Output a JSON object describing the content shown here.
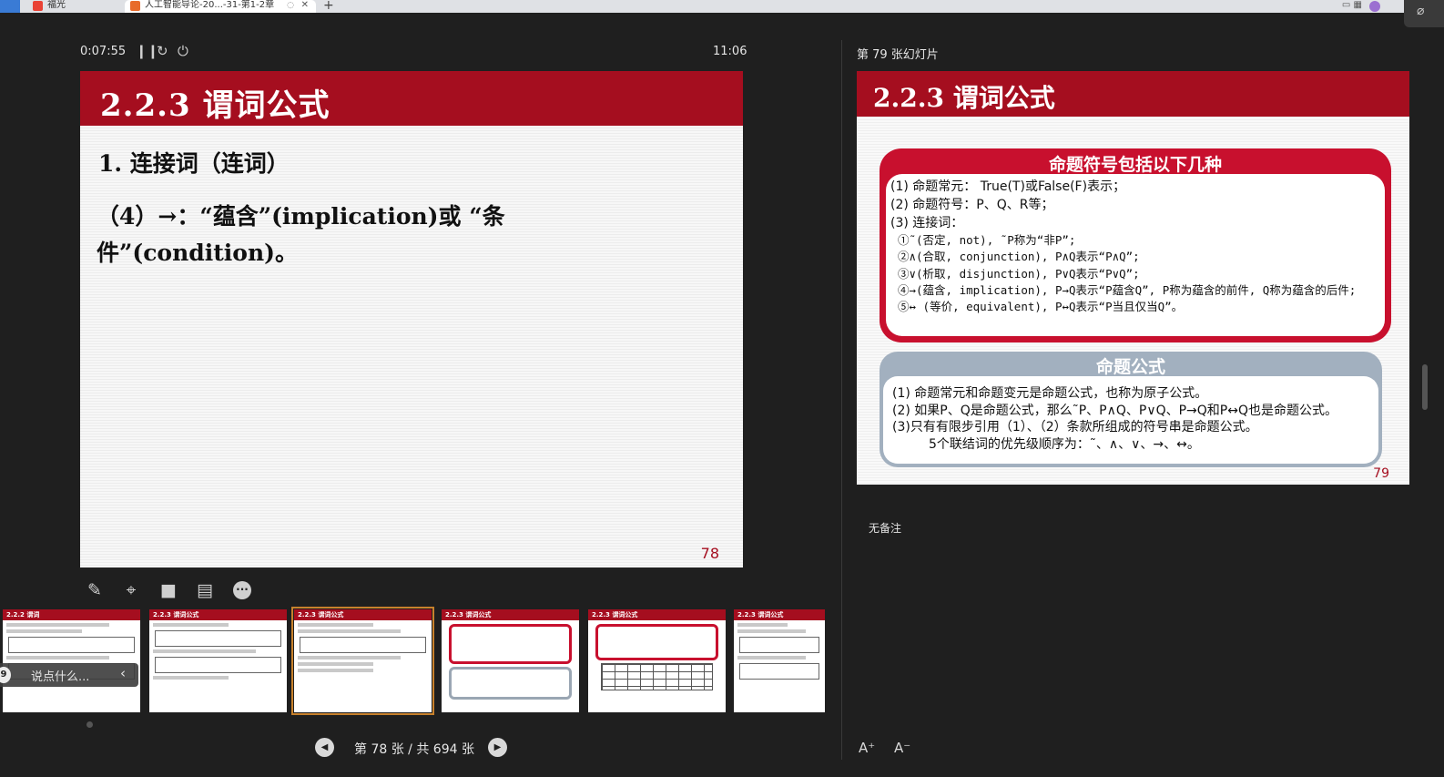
{
  "browser": {
    "tab1_label": "福光",
    "tab2_label": "人工智能导论-20...-31-第1-2章",
    "tab2_close": "✕",
    "newtab": "+"
  },
  "presenter": {
    "elapsed": "0:07:55",
    "pause_icon": "pause-icon",
    "restart_icon": "restart-icon",
    "end_icon": "power-icon",
    "clock": "11:06"
  },
  "current_slide": {
    "title": "2.2.3  谓词公式",
    "line1": "1. 连接词（连词）",
    "line2": "（4）→：“蕴含”(implication)或 “条件”(condition)。",
    "page": "78"
  },
  "tools": [
    "pen-icon",
    "laser-pointer-icon",
    "camera-icon",
    "subtitle-icon",
    "more-icon"
  ],
  "thumbnails": [
    {
      "title": "2.2.2  谓词",
      "selected": false
    },
    {
      "title": "2.2.3  谓词公式",
      "selected": false
    },
    {
      "title": "2.2.3  谓词公式",
      "selected": true
    },
    {
      "title": "2.2.3  谓词公式",
      "selected": false
    },
    {
      "title": "2.2.3  谓词公式",
      "selected": false
    },
    {
      "title": "2.2.3  谓词公式",
      "selected": false
    }
  ],
  "chat": {
    "placeholder": "说点什么..."
  },
  "navigation": {
    "count": "第 78 张 / 共 694 张"
  },
  "next_slide": {
    "label": "第 79 张幻灯片",
    "title": "2.2.3  谓词公式",
    "page": "79",
    "red_panel": {
      "title": "命题符号包括以下几种",
      "lines": [
        "(1) 命题常元： True(T)或False(F)表示；",
        "(2) 命题符号：P、Q、R等；",
        "(3) 连接词："
      ],
      "sublines": [
        "①˜(否定, not), ˜P称为“非P”;",
        "②∧(合取, conjunction), P∧Q表示“P∧Q”;",
        "③∨(析取, disjunction), P∨Q表示“P∨Q”;",
        "④→(蕴含, implication), P→Q表示“P蕴含Q”, P称为蕴含的前件, Q称为蕴含的后件;",
        "⑤↔ (等价, equivalent), P↔Q表示“P当且仅当Q”。"
      ]
    },
    "grey_panel": {
      "title": "命题公式",
      "lines": [
        "(1) 命题常元和命题变元是命题公式，也称为原子公式。",
        "(2) 如果P、Q是命题公式，那么˜P、P∧Q、P∨Q、P→Q和P↔Q也是命题公式。",
        "(3)只有有限步引用（1）、（2）条款所组成的符号串是命题公式。",
        "5个联结词的优先级顺序为：˜、∧、∨、→、↔。"
      ]
    }
  },
  "notes": "无备注",
  "font_controls": {
    "increase": "A⁺",
    "decrease": "A⁻"
  }
}
